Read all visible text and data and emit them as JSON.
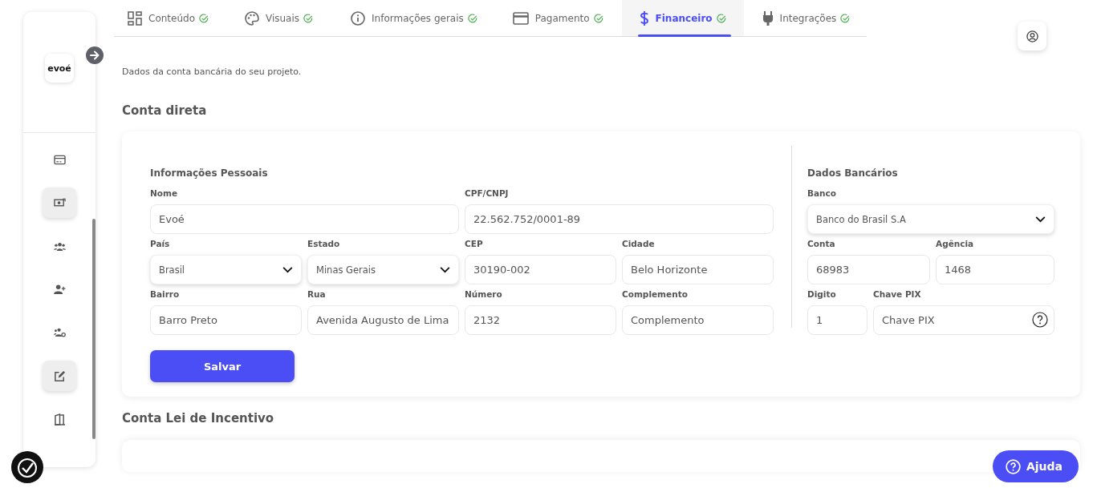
{
  "sidebar": {
    "logo": "evoé",
    "items": [
      {
        "kind": "card",
        "selected": false
      },
      {
        "kind": "money",
        "selected": true
      },
      {
        "kind": "group",
        "selected": false
      },
      {
        "kind": "user-plus",
        "selected": false
      },
      {
        "kind": "group-gear",
        "selected": false
      },
      {
        "kind": "edit",
        "selected": true
      },
      {
        "kind": "door",
        "selected": false
      }
    ]
  },
  "tabs": [
    {
      "label": "Conteúdo",
      "kind": "grid",
      "done": true,
      "selected": false
    },
    {
      "label": "Visuais",
      "kind": "palette",
      "done": true,
      "selected": false
    },
    {
      "label": "Informações gerais",
      "kind": "info",
      "done": true,
      "selected": false
    },
    {
      "label": "Pagamento",
      "kind": "card",
      "done": true,
      "selected": false
    },
    {
      "label": "Financeiro",
      "kind": "dollar",
      "done": true,
      "selected": true
    },
    {
      "label": "Integrações",
      "kind": "plug",
      "done": true,
      "selected": false
    }
  ],
  "description": "Dados da conta bancária do seu projeto.",
  "section_title": "Conta direta",
  "personal": {
    "title": "Informações Pessoais",
    "fields": [
      {
        "label": "Nome",
        "kind": "input",
        "value": "Evoé"
      },
      {
        "label": "CPF/CNPJ",
        "kind": "input",
        "value": "22.562.752/0001-89"
      },
      {
        "label": "País",
        "kind": "select",
        "value": "Brasil"
      },
      {
        "label": "Estado",
        "kind": "select",
        "value": "Minas Gerais"
      },
      {
        "label": "CEP",
        "kind": "input",
        "value": "30190-002"
      },
      {
        "label": "Cidade",
        "kind": "input",
        "value": "Belo Horizonte"
      },
      {
        "label": "Bairro",
        "kind": "input",
        "value": "Barro Preto"
      },
      {
        "label": "Rua",
        "kind": "input",
        "value": "Avenida Augusto de Lima"
      },
      {
        "label": "Número",
        "kind": "input",
        "value": "2132"
      },
      {
        "label": "Complemento",
        "kind": "input",
        "placeholder": "Complemento"
      }
    ]
  },
  "bank": {
    "title": "Dados Bancários",
    "fields": [
      {
        "label": "Banco",
        "kind": "select",
        "value": "Banco do Brasil S.A"
      },
      {
        "label": "Conta",
        "kind": "input",
        "value": "68983"
      },
      {
        "label": "Agência",
        "kind": "input",
        "value": "1468"
      },
      {
        "label": "Digito",
        "kind": "input",
        "value": "1"
      },
      {
        "label": "Chave PIX",
        "kind": "help",
        "placeholder": "Chave PIX"
      }
    ]
  },
  "save_button": "Salvar",
  "section2_title": "Conta Lei de Incentivo",
  "help_button": "Ajuda"
}
